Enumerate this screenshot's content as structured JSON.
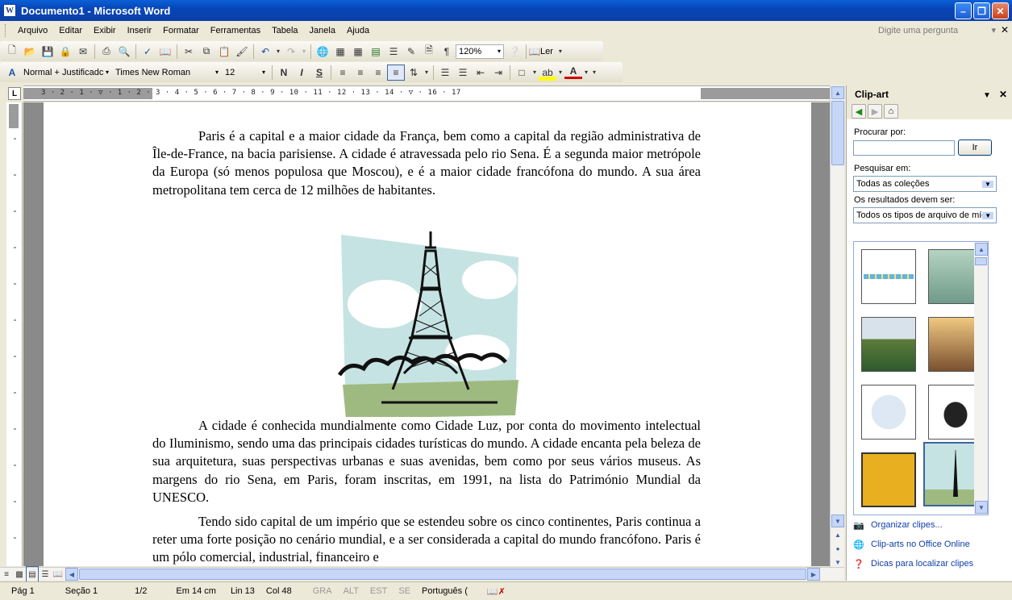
{
  "window": {
    "title": "Documento1 - Microsoft Word"
  },
  "menu": {
    "items": [
      "Arquivo",
      "Editar",
      "Exibir",
      "Inserir",
      "Formatar",
      "Ferramentas",
      "Tabela",
      "Janela",
      "Ajuda"
    ],
    "ask_placeholder": "Digite uma pergunta"
  },
  "toolbar": {
    "zoom": "120%",
    "read_label": "Ler",
    "style": "Normal + Justificadc",
    "font": "Times New Roman",
    "size": "12",
    "bold": "N",
    "italic": "I",
    "underline": "S"
  },
  "ruler": {
    "numbers": "3 · 2 · 1 · ▽ · 1 · 2 · 3 · 4 · 5 · 6 · 7 · 8 · 9 · 10 · 11 · 12 · 13 · 14 · ▽ · 16 · 17"
  },
  "document": {
    "paragraphs": [
      "Paris é a capital e a maior cidade da França, bem como a capital da região administrativa de Île-de-France, na bacia parisiense. A cidade é atravessada pelo rio Sena. É a segunda maior metrópole da Europa (só menos populosa que Moscou), e é a maior cidade francófona do mundo. A sua área metropolitana tem cerca de 12 milhões de habitantes.",
      "A cidade é conhecida mundialmente como Cidade Luz, por conta do movimento intelectual do Iluminismo, sendo uma das principais cidades turísticas do mundo. A cidade encanta pela beleza de sua arquitetura, suas perspectivas urbanas e suas avenidas, bem como por seus vários museus. As margens do rio Sena, em Paris, foram inscritas, em 1991, na lista do Património Mundial da UNESCO.",
      "Tendo sido capital de um império que se estendeu sobre os cinco continentes, Paris continua a reter uma forte posição no cenário mundial, e a ser considerada a capital do mundo francófono. Paris é um pólo comercial, industrial, financeiro e"
    ]
  },
  "taskpane": {
    "title": "Clip-art",
    "search_label": "Procurar por:",
    "search_value": "",
    "go_button": "Ir",
    "search_in_label": "Pesquisar em:",
    "search_in_value": "Todas as coleções",
    "results_label": "Os resultados devem ser:",
    "results_value": "Todos os tipos de arquivo de míd",
    "links": [
      "Organizar clipes...",
      "Clip-arts no Office Online",
      "Dicas para localizar clipes"
    ]
  },
  "status": {
    "page": "Pág 1",
    "section": "Seção 1",
    "pages": "1/2",
    "at": "Em 14 cm",
    "line": "Lin 13",
    "col": "Col 48",
    "rec": "GRA",
    "trk": "ALT",
    "ext": "EST",
    "ovr": "SE",
    "language": "Português ("
  }
}
